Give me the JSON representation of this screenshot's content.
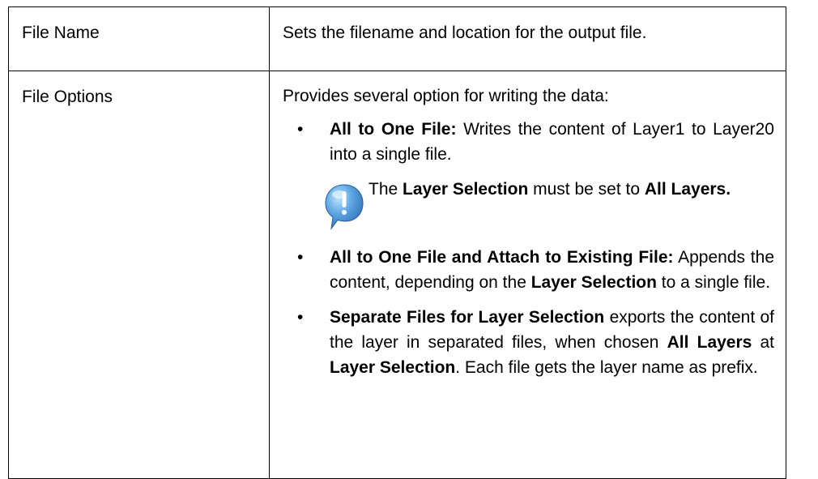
{
  "rows": [
    {
      "name": "File Name",
      "description": "Sets the filename and location for the output file."
    },
    {
      "name": "File Options",
      "intro": "Provides several option for writing the data:",
      "bullets": [
        {
          "bold_lead": "All to One File:",
          "text": " Writes the content of Layer1 to Layer20 into a single file."
        },
        {
          "bold_lead": "All to One File and Attach to Existing File:",
          "text_before": " Appends the content, depending on the ",
          "bold_mid": "Layer Selection",
          "text_after": " to a single file."
        },
        {
          "bold_lead": "Separate Files for Layer Selection",
          "text_before": " exports the content of the layer in separated files, when chosen ",
          "bold_mid1": "All Layers",
          "text_mid": " at ",
          "bold_mid2": "Layer Selection",
          "text_after": ". Each file gets the layer name as prefix."
        }
      ],
      "note": {
        "icon": "info-exclamation-icon",
        "prefix": "The ",
        "bold_a": "Layer Selection",
        "middle": " must be set to ",
        "bold_b": "All Layers."
      }
    }
  ],
  "colors": {
    "text": "#000000",
    "border": "#000000",
    "icon_blue": "#3a7fc9",
    "icon_light": "#9fd0f5"
  },
  "bullet_char": "•"
}
